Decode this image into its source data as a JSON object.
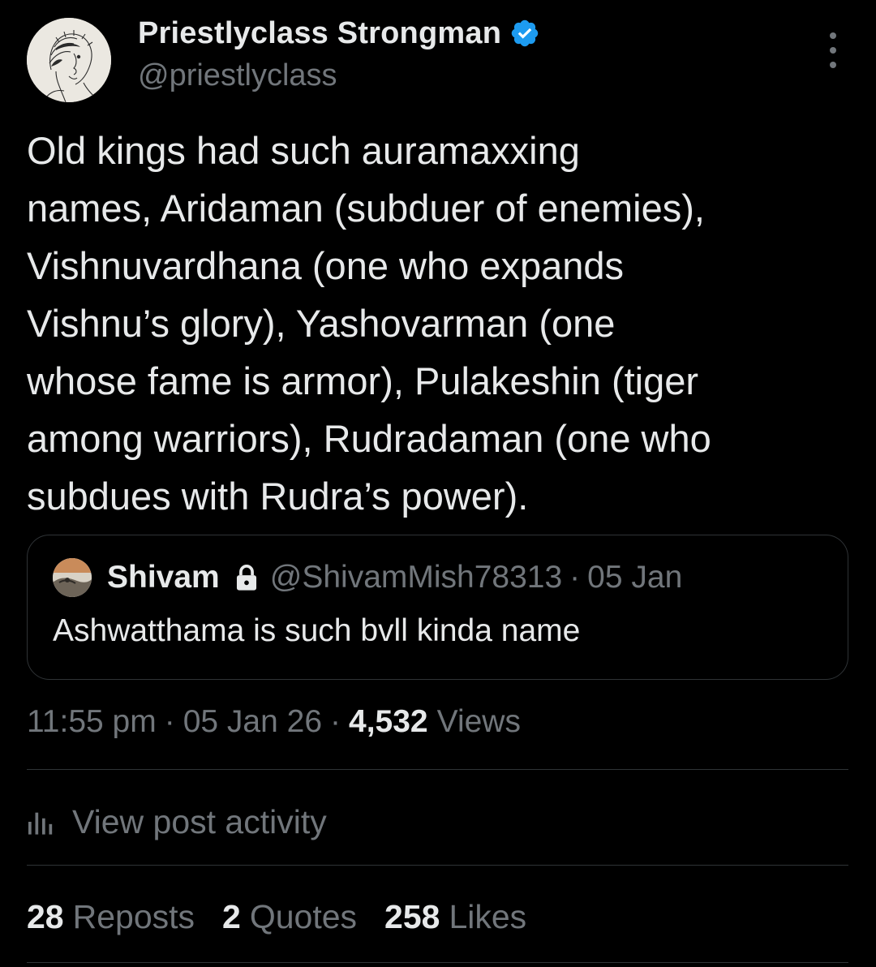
{
  "post": {
    "author": {
      "display_name": "Priestlyclass Strongman",
      "handle": "@priestlyclass",
      "verified": true
    },
    "text": "Old kings had such auramaxxing\nnames, Aridaman (subduer of enemies),\nVishnuvardhana (one who expands\nVishnu’s glory), Yashovarman (one\nwhose fame is armor), Pulakeshin (tiger\namong warriors), Rudradaman (one who\nsubdues with Rudra’s power).",
    "quoted": {
      "display_name": "Shivam",
      "handle": "@ShivamMish78313",
      "separator": "·",
      "date": "05 Jan",
      "text": "Ashwatthama is such bvll kinda name"
    },
    "time": "11:55 pm",
    "date": "05 Jan 26",
    "separator": "·",
    "views_count": "4,532",
    "views_label": "Views",
    "activity_label": "View post activity",
    "stats": [
      {
        "count": "28",
        "label": "Reposts"
      },
      {
        "count": "2",
        "label": "Quotes"
      },
      {
        "count": "258",
        "label": "Likes"
      }
    ]
  },
  "colors": {
    "background": "#000000",
    "primary_text": "#e7e9ea",
    "secondary_text": "#71767b",
    "verified_badge": "#1d9bf0",
    "border": "#2f3336"
  },
  "icons": {
    "verified": "verified-badge-icon",
    "more": "more-vertical-icon",
    "lock": "lock-icon",
    "activity": "bar-chart-icon"
  }
}
